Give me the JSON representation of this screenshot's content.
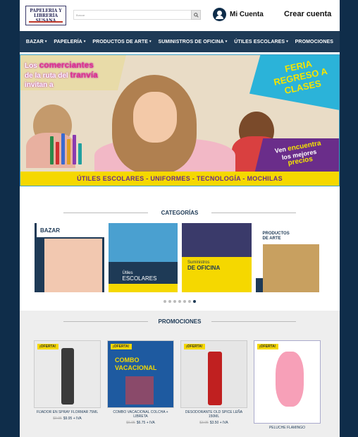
{
  "header": {
    "logo_line1": "PAPELERIA Y",
    "logo_line2": "LIBRERÍA",
    "logo_line3": "SUSANA",
    "search_placeholder": "Buscar",
    "account_label": "Mi Cuenta",
    "create_account_label": "Crear cuenta"
  },
  "nav": [
    {
      "label": "BAZAR",
      "caret": "▾"
    },
    {
      "label": "PAPELERÍA",
      "caret": "▾"
    },
    {
      "label": "PRODUCTOS DE ARTE",
      "caret": "▾"
    },
    {
      "label": "SUMINISTROS DE OFICINA",
      "caret": "▾"
    },
    {
      "label": "ÚTILES ESCOLARES",
      "caret": "▾"
    },
    {
      "label": "PROMOCIONES",
      "caret": ""
    }
  ],
  "banner": {
    "line1_a": "Los ",
    "line1_b": "comerciantes",
    "line2_a": "de la ruta del ",
    "line2_b": "tranvía",
    "line3": "invitan a",
    "feria": "FERIA REGRESO A CLASES",
    "precios_a": "Ven ",
    "precios_b": "encuentra",
    "precios_c": "los mejores",
    "precios_d": "precios",
    "strip": "ÚTILES ESCOLARES - UNIFORMES - TECNOLOGÍA - MOCHILAS"
  },
  "categories": {
    "title": "CATEGORÍAS",
    "items": [
      {
        "label": "BAZAR"
      },
      {
        "label_small": "Útiles",
        "label_big": "ESCOLARES"
      },
      {
        "label_small": "Suministros",
        "label_big": "DE OFICINA"
      },
      {
        "label": "PRODUCTOS DE ARTE"
      }
    ],
    "dots_total": 7,
    "dots_active": 7
  },
  "promotions": {
    "title": "PROMOCIONES",
    "items": [
      {
        "badge": "¡OFERTA!",
        "name": "FIJADOR EN SPRAY FLORMAR 75ML",
        "old": "$9.95",
        "price": "$9.95 + IVA"
      },
      {
        "badge": "¡OFERTA!",
        "name": "COMBO VACACIONAL COLCHA + LIBRETA",
        "old": "$6.95",
        "price": "$6.75 + IVA",
        "art": "COMBO VACACIONAL"
      },
      {
        "badge": "¡OFERTA!",
        "name": "DESODORANTE OLD SPICE LEÑA 150ML",
        "old": "$3.95",
        "price": "$3.50 + IVA"
      },
      {
        "badge": "¡OFERTA!",
        "name": "PELUCHE FLAMINGO",
        "old": "",
        "price": ""
      }
    ]
  }
}
